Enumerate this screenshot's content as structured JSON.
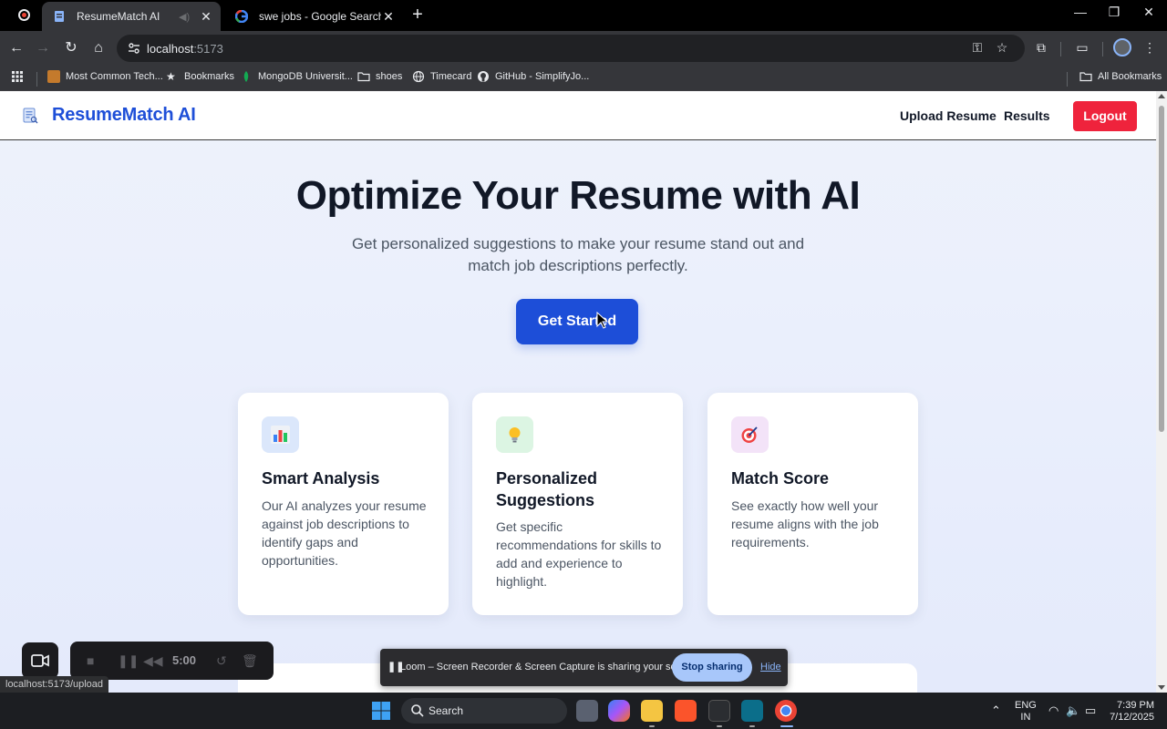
{
  "browser": {
    "tabs": [
      {
        "title": "ResumeMatch AI",
        "active": true
      },
      {
        "title": "swe jobs - Google Search",
        "active": false
      }
    ],
    "url_host": "localhost",
    "url_port": ":5173",
    "bookmarks": [
      {
        "label": "Most Common Tech...",
        "icon": "bookmark-favicon-icon"
      },
      {
        "label": "Bookmarks",
        "icon": "star-icon"
      },
      {
        "label": "MongoDB Universit...",
        "icon": "mongodb-leaf-icon"
      },
      {
        "label": "shoes",
        "icon": "folder-icon"
      },
      {
        "label": "Timecard",
        "icon": "globe-icon"
      },
      {
        "label": "GitHub - SimplifyJo...",
        "icon": "github-icon"
      }
    ],
    "all_bookmarks": "All Bookmarks",
    "status_url": "localhost:5173/upload"
  },
  "app": {
    "brand": "ResumeMatch AI",
    "nav": {
      "upload": "Upload Resume",
      "results": "Results",
      "logout": "Logout"
    },
    "hero": {
      "title": "Optimize Your Resume with AI",
      "subtitle": "Get personalized suggestions to make your resume stand out and match job descriptions perfectly.",
      "cta": "Get Started"
    },
    "features": [
      {
        "icon": "bar-chart-icon",
        "title": "Smart Analysis",
        "desc": "Our AI analyzes your resume against job descriptions to identify gaps and opportunities.",
        "tint": "#dbe7fb"
      },
      {
        "icon": "lightbulb-icon",
        "title": "Personalized Suggestions",
        "desc": "Get specific recommendations for skills to add and experience to highlight.",
        "tint": "#dcf5e3"
      },
      {
        "icon": "target-icon",
        "title": "Match Score",
        "desc": "See exactly how well your resume aligns with the job requirements.",
        "tint": "#f3e3f8"
      }
    ],
    "colors": {
      "brand": "#1e4fd8",
      "cta": "#1d4ed8",
      "logout": "#ef233c"
    }
  },
  "loom": {
    "timer": "5:00",
    "share_message": "Loom – Screen Recorder & Screen Capture is sharing your screen.",
    "stop_label": "Stop sharing",
    "hide_label": "Hide"
  },
  "taskbar": {
    "search_label": "Search",
    "lang_line1": "ENG",
    "lang_line2": "IN",
    "time": "7:39 PM",
    "date": "7/12/2025"
  }
}
